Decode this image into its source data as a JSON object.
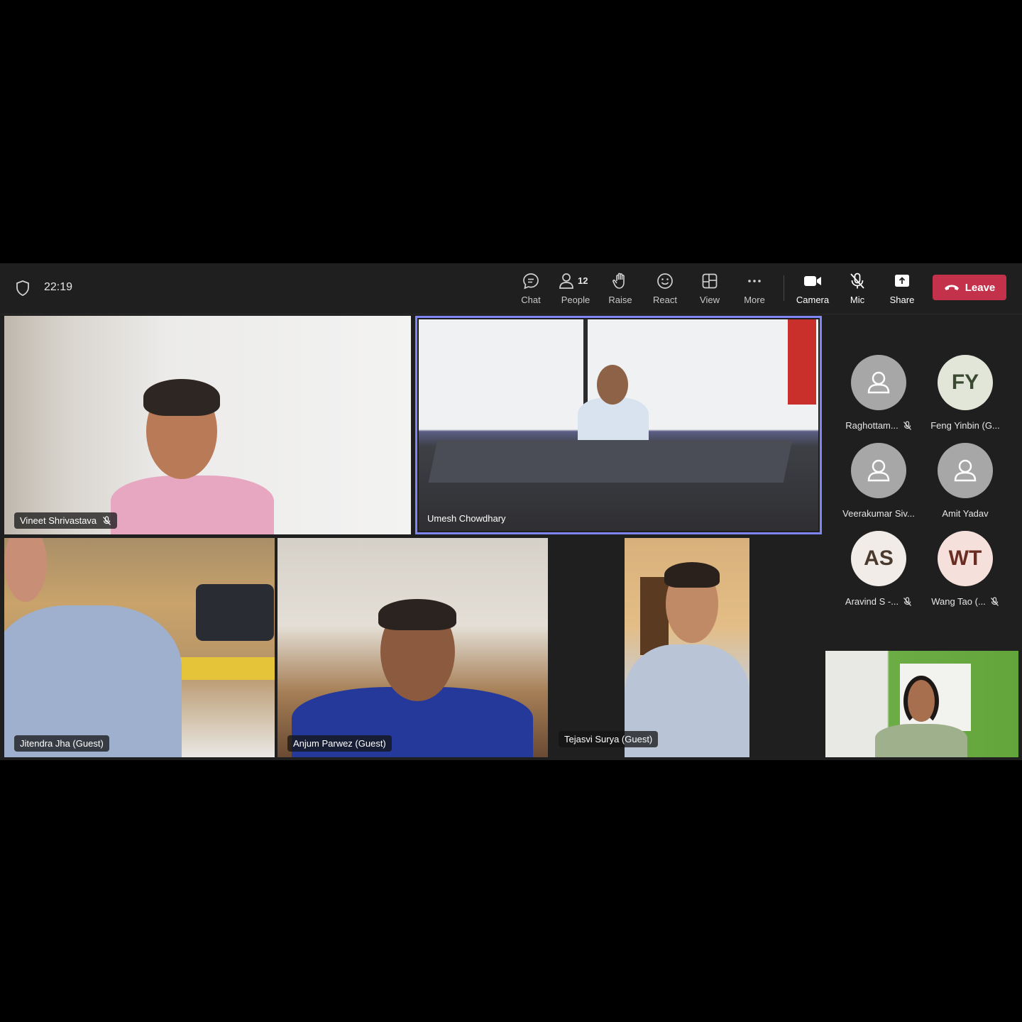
{
  "meeting": {
    "time": "22:19"
  },
  "toolbar": {
    "chat": "Chat",
    "people": "People",
    "people_count": "12",
    "raise": "Raise",
    "react": "React",
    "view": "View",
    "more": "More",
    "camera": "Camera",
    "mic": "Mic",
    "share": "Share",
    "leave": "Leave"
  },
  "tiles": [
    {
      "name": "Vineet Shrivastava",
      "muted": true
    },
    {
      "name": "Umesh Chowdhary",
      "muted": false,
      "active_speaker": true
    },
    {
      "name": "Jitendra Jha (Guest)",
      "muted": false
    },
    {
      "name": "Anjum Parwez (Guest)",
      "muted": false
    },
    {
      "name": "Tejasvi Surya (Guest)",
      "muted": false
    }
  ],
  "roster": [
    {
      "name": "Raghottam...",
      "avatar": "person-icon",
      "muted": true
    },
    {
      "name": "Feng Yinbin (G...",
      "avatar": "FY",
      "muted": false
    },
    {
      "name": "Veerakumar Siv...",
      "avatar": "person-icon",
      "muted": false
    },
    {
      "name": "Amit Yadav",
      "avatar": "person-icon",
      "muted": false
    },
    {
      "name": "Aravind S -...",
      "avatar": "AS",
      "muted": true
    },
    {
      "name": "Wang Tao (...",
      "avatar": "WT",
      "muted": true
    }
  ],
  "colors": {
    "leave": "#c4314b",
    "active_border": "#7f85f5",
    "background": "#1f1f1f"
  }
}
